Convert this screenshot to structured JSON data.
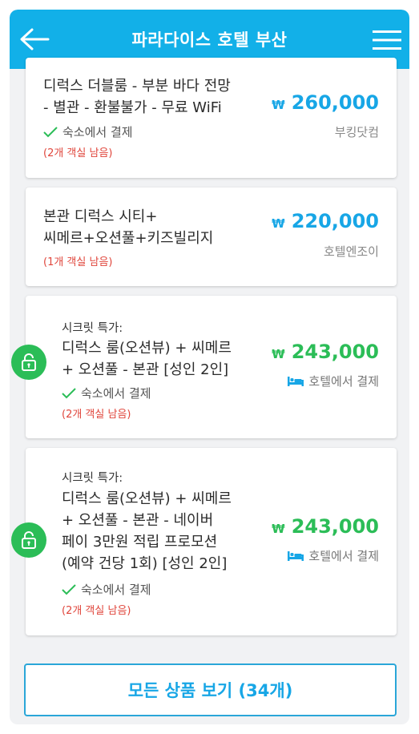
{
  "header": {
    "title": "파라다이스 호텔 부산"
  },
  "currency_symbol": "₩",
  "rooms": [
    {
      "name_lines": [
        "디럭스 더블룸 - 부분 바다 전망",
        "- 별관 - 환불불가 - 무료 WiFi"
      ],
      "pay_onsite": "숙소에서 결제",
      "rooms_left": "(2개 객실 남음)",
      "price": "260,000",
      "vendor": "부킹닷컴"
    },
    {
      "name_lines": [
        "본관 디럭스 시티+",
        "씨메르+오션풀+키즈빌리지"
      ],
      "rooms_left": "(1개 객실 남음)",
      "price": "220,000",
      "vendor": "호텔엔조이"
    },
    {
      "secret_label": "시크릿 특가:",
      "name_lines": [
        "디럭스 룸(오션뷰) + 씨메르",
        "+ 오션풀 - 본관 [성인 2인]"
      ],
      "pay_onsite": "숙소에서 결제",
      "rooms_left": "(2개 객실 남음)",
      "price": "243,000",
      "hotel_pay": "호텔에서 결제"
    },
    {
      "secret_label": "시크릿 특가:",
      "name_lines": [
        "디럭스 룸(오션뷰) + 씨메르",
        "+ 오션풀 - 본관 - 네이버",
        "페이 3만원 적립 프로모션",
        "(예약 건당 1회) [성인 2인]"
      ],
      "pay_onsite": "숙소에서 결제",
      "rooms_left": "(2개 객실 남음)",
      "price": "243,000",
      "hotel_pay": "호텔에서 결제"
    }
  ],
  "footer": {
    "all_products_label": "모든 상품 보기 (34개)"
  },
  "colors": {
    "header": "#12b0e8",
    "price_blue": "#17a6e6",
    "price_green": "#2bbd57",
    "rooms_left_red": "#e0463c"
  },
  "icons": [
    "back-arrow-icon",
    "hamburger-menu-icon",
    "check-icon",
    "unlock-icon",
    "bed-icon"
  ]
}
